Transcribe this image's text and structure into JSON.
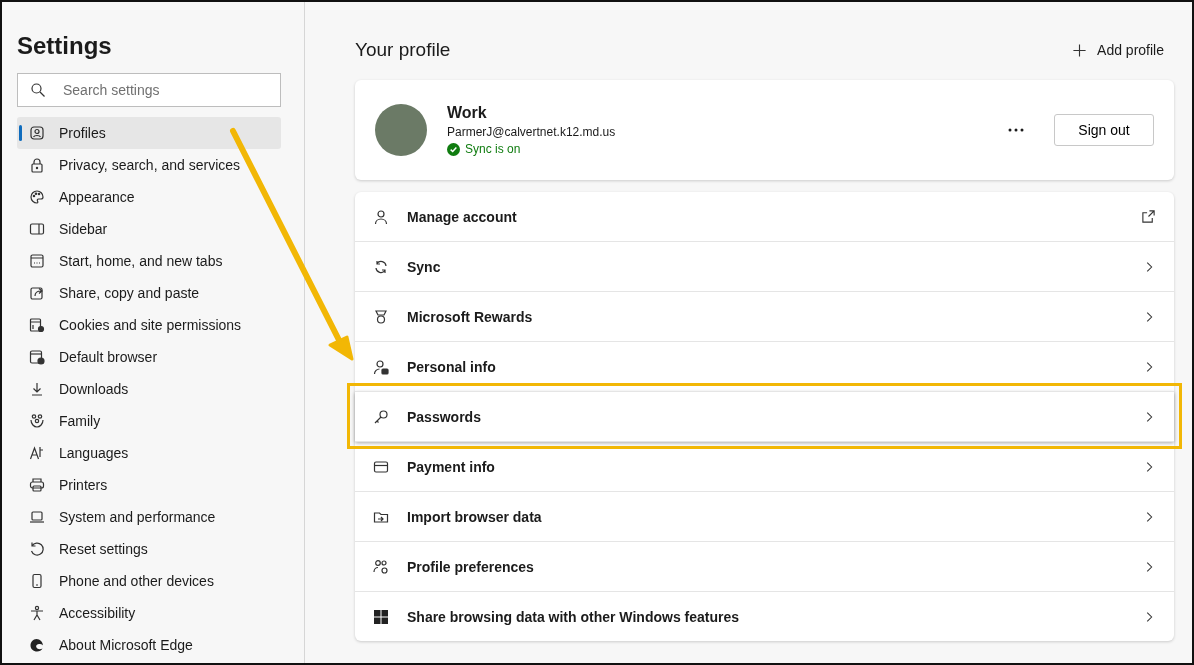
{
  "sidebar": {
    "title": "Settings",
    "search": {
      "placeholder": "Search settings"
    },
    "items": [
      {
        "label": "Profiles",
        "selected": true
      },
      {
        "label": "Privacy, search, and services",
        "selected": false
      },
      {
        "label": "Appearance",
        "selected": false
      },
      {
        "label": "Sidebar",
        "selected": false
      },
      {
        "label": "Start, home, and new tabs",
        "selected": false
      },
      {
        "label": "Share, copy and paste",
        "selected": false
      },
      {
        "label": "Cookies and site permissions",
        "selected": false
      },
      {
        "label": "Default browser",
        "selected": false
      },
      {
        "label": "Downloads",
        "selected": false
      },
      {
        "label": "Family",
        "selected": false
      },
      {
        "label": "Languages",
        "selected": false
      },
      {
        "label": "Printers",
        "selected": false
      },
      {
        "label": "System and performance",
        "selected": false
      },
      {
        "label": "Reset settings",
        "selected": false
      },
      {
        "label": "Phone and other devices",
        "selected": false
      },
      {
        "label": "Accessibility",
        "selected": false
      },
      {
        "label": "About Microsoft Edge",
        "selected": false
      }
    ]
  },
  "main": {
    "title": "Your profile",
    "add_profile": "Add profile",
    "profile": {
      "name": "Work",
      "email": "ParmerJ@calvertnet.k12.md.us",
      "sync_status": "Sync is on",
      "sign_out": "Sign out"
    },
    "rows": [
      {
        "label": "Manage account",
        "kind": "external",
        "highlighted": false
      },
      {
        "label": "Sync",
        "kind": "chevron",
        "highlighted": false
      },
      {
        "label": "Microsoft Rewards",
        "kind": "chevron",
        "highlighted": false
      },
      {
        "label": "Personal info",
        "kind": "chevron",
        "highlighted": false
      },
      {
        "label": "Passwords",
        "kind": "chevron",
        "highlighted": true
      },
      {
        "label": "Payment info",
        "kind": "chevron",
        "highlighted": false
      },
      {
        "label": "Import browser data",
        "kind": "chevron",
        "highlighted": false
      },
      {
        "label": "Profile preferences",
        "kind": "chevron",
        "highlighted": false
      },
      {
        "label": "Share browsing data with other Windows features",
        "kind": "chevron",
        "highlighted": false
      }
    ]
  },
  "annotation_arrow": true
}
